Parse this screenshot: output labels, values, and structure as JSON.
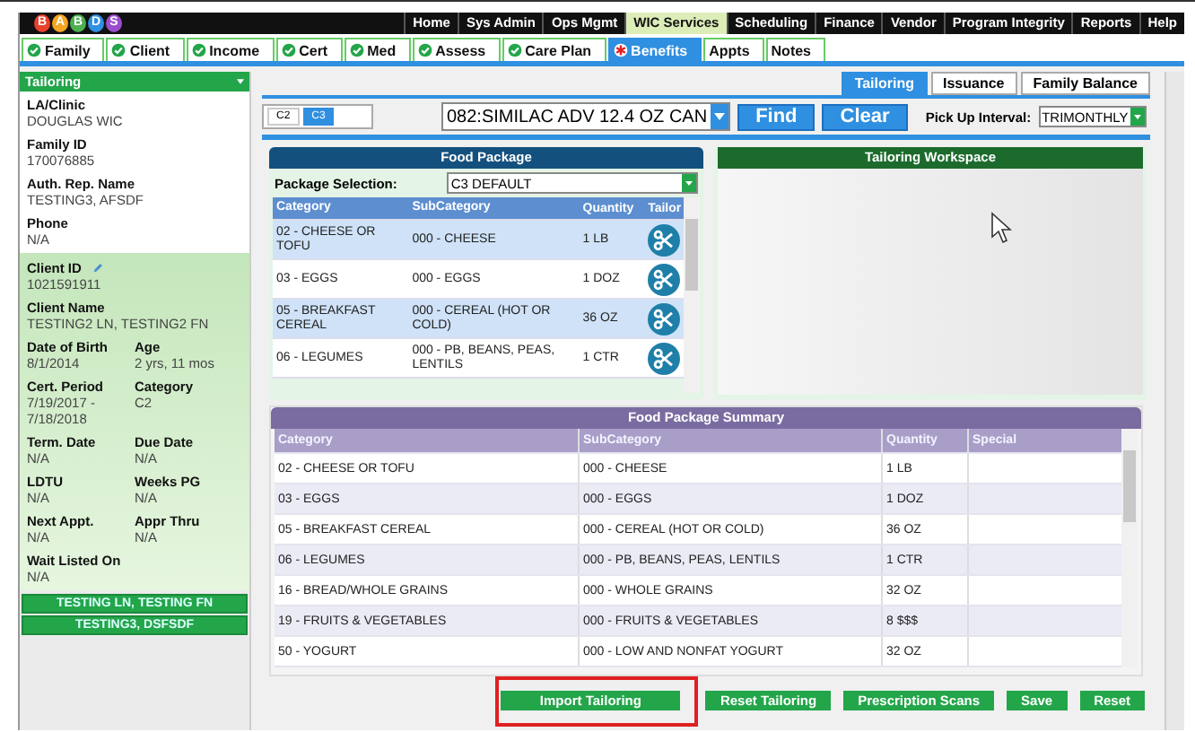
{
  "logo": {
    "letters": [
      "B",
      "A",
      "B",
      "D",
      "S"
    ]
  },
  "nav": [
    {
      "label": "Home",
      "selected": false
    },
    {
      "label": "Sys Admin",
      "selected": false
    },
    {
      "label": "Ops Mgmt",
      "selected": false
    },
    {
      "label": "WIC Services",
      "selected": true
    },
    {
      "label": "Scheduling",
      "selected": false
    },
    {
      "label": "Finance",
      "selected": false
    },
    {
      "label": "Vendor",
      "selected": false
    },
    {
      "label": "Program Integrity",
      "selected": false
    },
    {
      "label": "Reports",
      "selected": false
    },
    {
      "label": "Help",
      "selected": false
    }
  ],
  "tabs": [
    {
      "label": "Family",
      "complete": true,
      "required": false,
      "selected": false
    },
    {
      "label": "Client",
      "complete": true,
      "required": false,
      "selected": false
    },
    {
      "label": "Income",
      "complete": true,
      "required": false,
      "selected": false
    },
    {
      "label": "Cert",
      "complete": true,
      "required": false,
      "selected": false
    },
    {
      "label": "Med",
      "complete": true,
      "required": false,
      "selected": false
    },
    {
      "label": "Assess",
      "complete": true,
      "required": false,
      "selected": false
    },
    {
      "label": "Care Plan",
      "complete": true,
      "required": false,
      "selected": false
    },
    {
      "label": "Benefits",
      "complete": false,
      "required": true,
      "selected": true
    },
    {
      "label": "Appts",
      "complete": false,
      "required": false,
      "selected": false
    },
    {
      "label": "Notes",
      "complete": false,
      "required": false,
      "selected": false
    }
  ],
  "sidebar": {
    "dropdown": "Tailoring",
    "family_fields": [
      {
        "label": "LA/Clinic",
        "value": "DOUGLAS WIC"
      },
      {
        "label": "Family ID",
        "value": "170076885"
      },
      {
        "label": "Auth. Rep. Name",
        "value": "TESTING3, AFSDF"
      },
      {
        "label": "Phone",
        "value": "N/A"
      }
    ],
    "client_id": {
      "label": "Client ID",
      "value": "1021591911"
    },
    "client_name": {
      "label": "Client Name",
      "value": "TESTING2 LN, TESTING2 FN"
    },
    "client_fields": [
      {
        "label": "Date of Birth",
        "value": "8/1/2014"
      },
      {
        "label": "Age",
        "value": "2 yrs, 11 mos"
      },
      {
        "label": "Cert. Period",
        "value": "7/19/2017 - 7/18/2018"
      },
      {
        "label": "Category",
        "value": "C2"
      },
      {
        "label": "Term. Date",
        "value": "N/A"
      },
      {
        "label": "Due Date",
        "value": "N/A"
      },
      {
        "label": "LDTU",
        "value": "N/A"
      },
      {
        "label": "Weeks PG",
        "value": "N/A"
      },
      {
        "label": "Next Appt.",
        "value": "N/A"
      },
      {
        "label": "Appr Thru",
        "value": "N/A"
      }
    ],
    "wait_listed": {
      "label": "Wait Listed On",
      "value": "N/A"
    },
    "members": [
      "TESTING LN, TESTING FN",
      "TESTING3, DSFSDF"
    ]
  },
  "subtabs": [
    {
      "label": "Tailoring",
      "selected": true
    },
    {
      "label": "Issuance",
      "selected": false
    },
    {
      "label": "Family Balance",
      "selected": false
    }
  ],
  "category_tabs": [
    {
      "label": "C2",
      "selected": false
    },
    {
      "label": "C3",
      "selected": true
    }
  ],
  "product_select": "082:SIMILAC ADV 12.4 OZ CAN",
  "find_button": "Find",
  "clear_button": "Clear",
  "pickup": {
    "label": "Pick Up Interval:",
    "value": "TRIMONTHLY"
  },
  "food_package": {
    "title": "Food Package",
    "selection_label": "Package Selection:",
    "selection": "C3 DEFAULT",
    "columns": [
      "Category",
      "SubCategory",
      "Quantity",
      "Tailor"
    ],
    "rows": [
      [
        "02 - CHEESE OR TOFU",
        "000 - CHEESE",
        "1 LB"
      ],
      [
        "03 - EGGS",
        "000 - EGGS",
        "1 DOZ"
      ],
      [
        "05 - BREAKFAST CEREAL",
        "000 - CEREAL (HOT OR COLD)",
        "36 OZ"
      ],
      [
        "06 - LEGUMES",
        "000 - PB, BEANS, PEAS, LENTILS",
        "1 CTR"
      ]
    ]
  },
  "workspace": {
    "title": "Tailoring Workspace"
  },
  "summary": {
    "title": "Food Package Summary",
    "columns": [
      "Category",
      "SubCategory",
      "Quantity",
      "Special"
    ],
    "rows": [
      [
        "02 - CHEESE OR TOFU",
        "000 - CHEESE",
        "1 LB"
      ],
      [
        "03 - EGGS",
        "000 - EGGS",
        "1 DOZ"
      ],
      [
        "05 - BREAKFAST CEREAL",
        "000 - CEREAL (HOT OR COLD)",
        "36 OZ"
      ],
      [
        "06 - LEGUMES",
        "000 - PB, BEANS, PEAS, LENTILS",
        "1 CTR"
      ],
      [
        "16 - BREAD/WHOLE GRAINS",
        "000 - WHOLE GRAINS",
        "32 OZ"
      ],
      [
        "19 - FRUITS & VEGETABLES",
        "000 - FRUITS & VEGETABLES",
        "8 $$$"
      ],
      [
        "50 - YOGURT",
        "000 - LOW AND NONFAT YOGURT",
        "32 OZ"
      ]
    ]
  },
  "actions": [
    {
      "label": "Import Tailoring",
      "highlighted": true
    },
    {
      "label": "Reset Tailoring",
      "highlighted": false
    },
    {
      "label": "Prescription Scans",
      "highlighted": false
    },
    {
      "label": "Save",
      "highlighted": false
    },
    {
      "label": "Reset",
      "highlighted": false
    }
  ]
}
